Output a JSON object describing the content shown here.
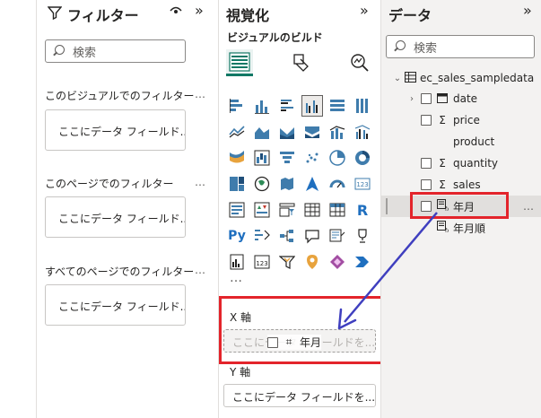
{
  "filters": {
    "title": "フィルター",
    "search_placeholder": "検索",
    "sections": [
      {
        "label": "このビジュアルでのフィルター",
        "more": "…",
        "well": "ここにデータ フィールド..."
      },
      {
        "label": "このページでのフィルター",
        "more": "…",
        "well": "ここにデータ フィールド..."
      },
      {
        "label": "すべてのページでのフィルター",
        "more": "…",
        "well": "ここにデータ フィールド..."
      }
    ]
  },
  "viz": {
    "title": "視覚化",
    "subtitle": "ビジュアルのビルド",
    "more": "…",
    "x_axis": {
      "label": "X 軸",
      "placeholder": "ここにデータ フィールドを...",
      "drag_field": "年月"
    },
    "y_axis": {
      "label": "Y 軸",
      "placeholder": "ここにデータ フィールドを..."
    }
  },
  "data": {
    "title": "データ",
    "search_placeholder": "検索",
    "table_name": "ec_sales_sampledata",
    "fields": [
      {
        "label": "date",
        "icon": "calendar-icon",
        "chevron": "›",
        "checkbox": true
      },
      {
        "label": "price",
        "icon": "sigma-icon",
        "glyph": "Σ",
        "checkbox": true
      },
      {
        "label": "product",
        "icon": "",
        "checkbox": false
      },
      {
        "label": "quantity",
        "icon": "sigma-icon",
        "glyph": "Σ",
        "checkbox": true
      },
      {
        "label": "sales",
        "icon": "sigma-icon",
        "glyph": "Σ",
        "checkbox": true
      },
      {
        "label": "年月",
        "icon": "calculated-field-icon",
        "checkbox": true,
        "highlighted": true,
        "more": "…"
      },
      {
        "label": "年月順",
        "icon": "calculated-field-icon",
        "checkbox": false
      }
    ]
  },
  "colors": {
    "highlight": "#e3242b",
    "arrow": "#3f3fbf",
    "accent": "#117865"
  }
}
